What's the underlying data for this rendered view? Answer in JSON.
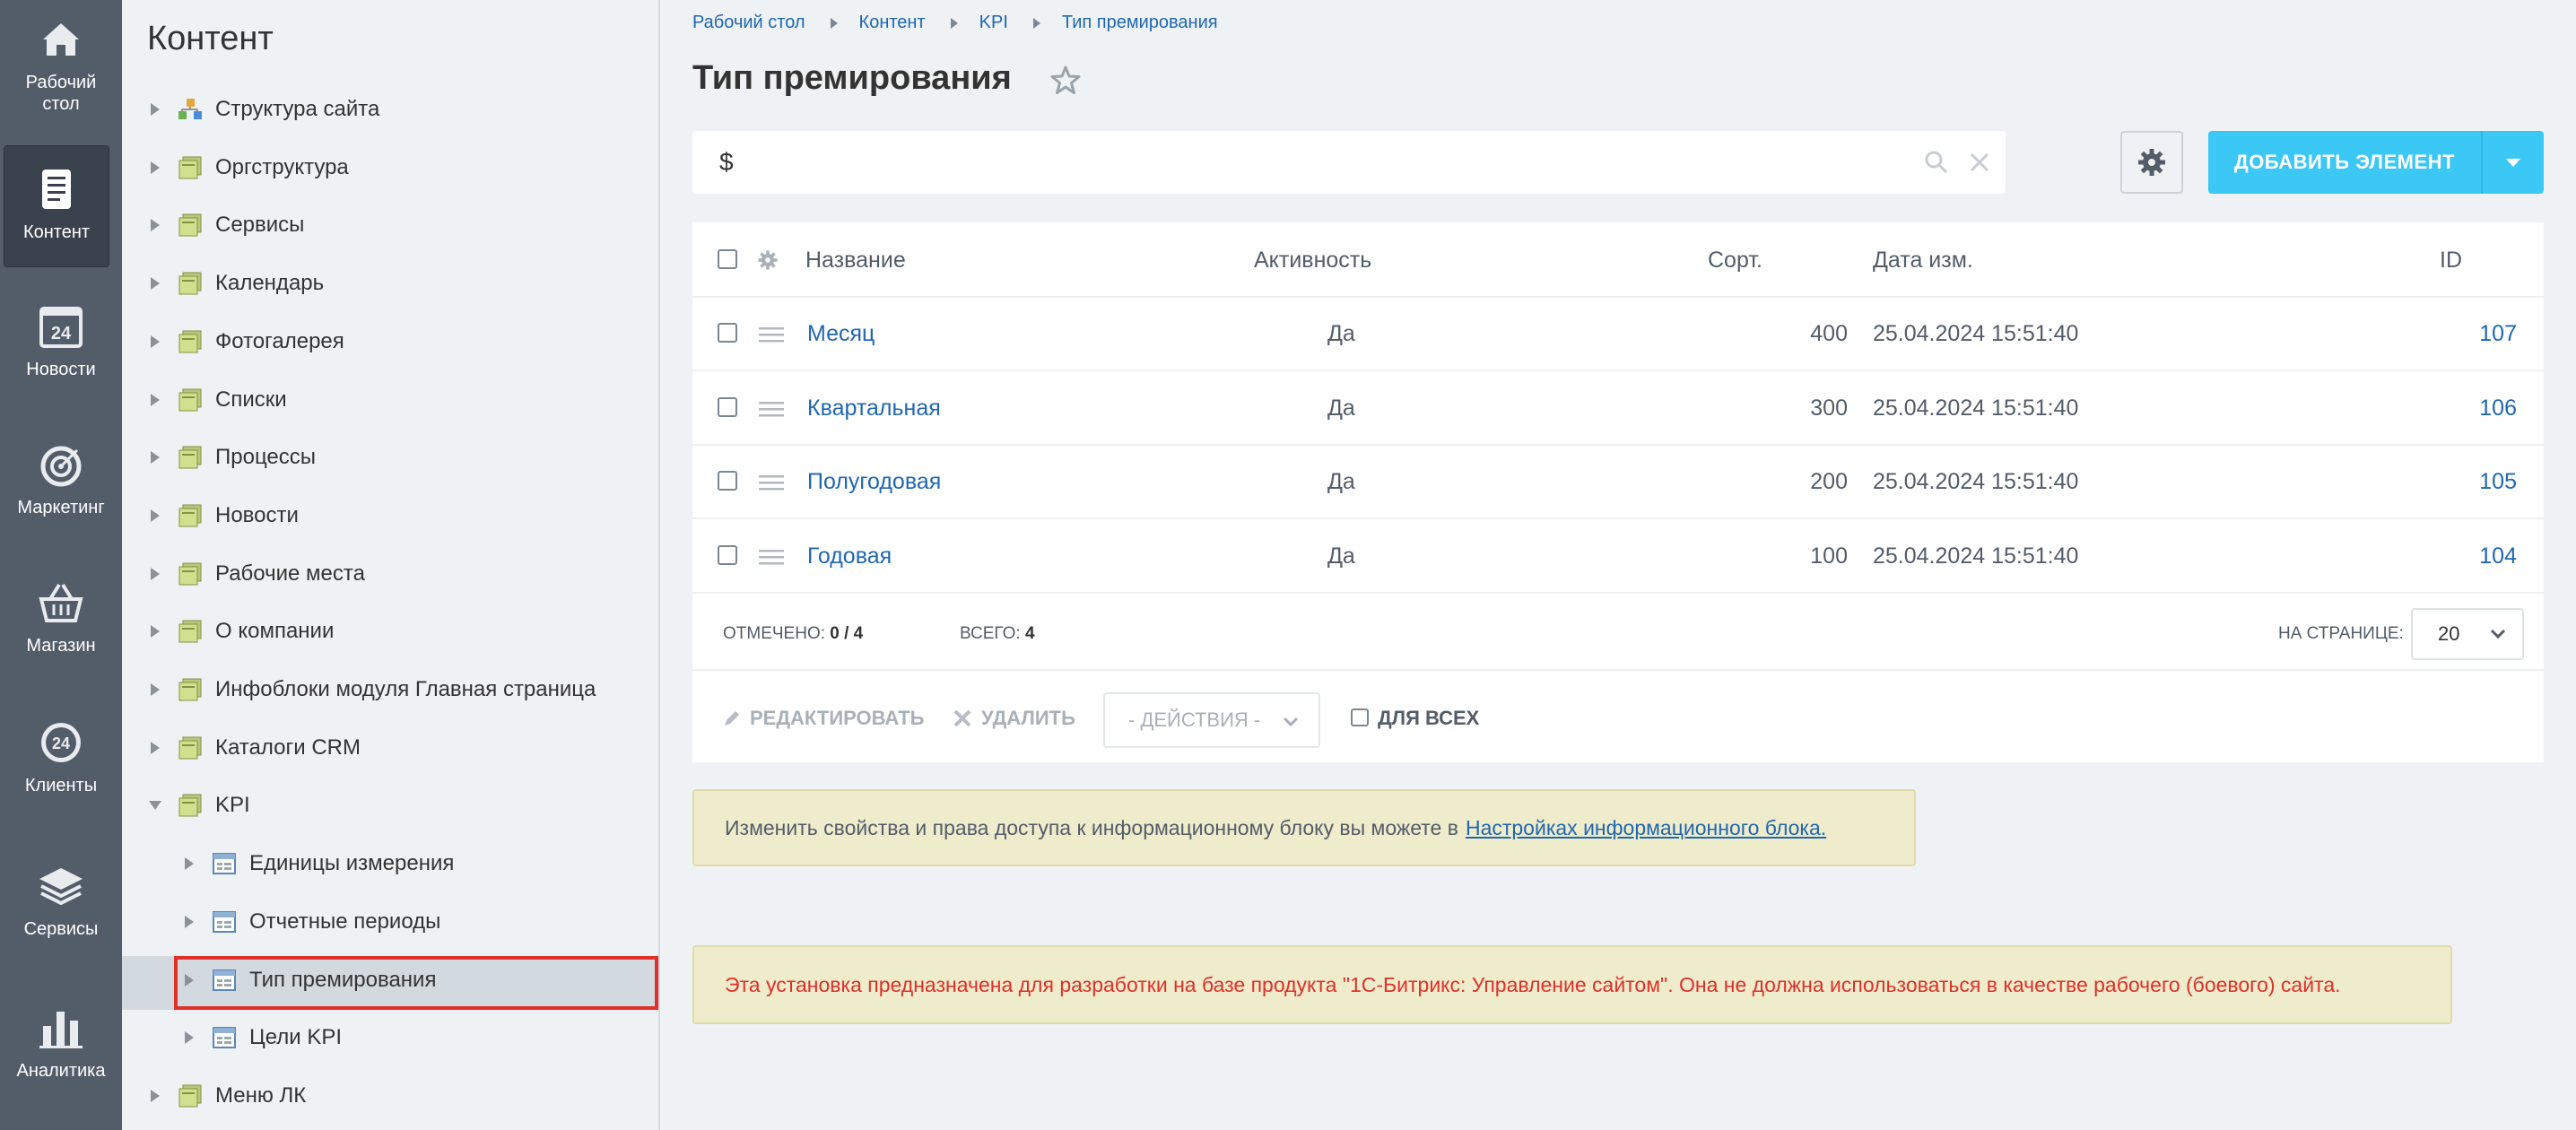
{
  "iconbar": {
    "items": [
      {
        "label_l1": "Рабочий",
        "label_l2": "стол",
        "icon": "home-icon"
      },
      {
        "label_l1": "Контент",
        "icon": "document-icon",
        "active": true
      },
      {
        "label_l1": "Новости",
        "icon": "calendar-24-icon"
      },
      {
        "label_l1": "Маркетинг",
        "icon": "target-icon"
      },
      {
        "label_l1": "Магазин",
        "icon": "basket-icon"
      },
      {
        "label_l1": "Клиенты",
        "icon": "clients-24-icon"
      },
      {
        "label_l1": "Сервисы",
        "icon": "layers-icon"
      },
      {
        "label_l1": "Аналитика",
        "icon": "bar-chart-icon"
      }
    ]
  },
  "tree": {
    "title": "Контент",
    "nodes": [
      {
        "label": "Структура сайта",
        "icon": "site-structure-icon"
      },
      {
        "label": "Оргструктура",
        "icon": "folder-icon"
      },
      {
        "label": "Сервисы",
        "icon": "folder-icon"
      },
      {
        "label": "Календарь",
        "icon": "folder-icon"
      },
      {
        "label": "Фотогалерея",
        "icon": "folder-icon"
      },
      {
        "label": "Списки",
        "icon": "folder-icon"
      },
      {
        "label": "Процессы",
        "icon": "folder-icon"
      },
      {
        "label": "Новости",
        "icon": "folder-icon"
      },
      {
        "label": "Рабочие места",
        "icon": "folder-icon"
      },
      {
        "label": "О компании",
        "icon": "folder-icon"
      },
      {
        "label": "Инфоблоки модуля Главная страница",
        "icon": "folder-icon"
      },
      {
        "label": "Каталоги CRM",
        "icon": "folder-icon"
      },
      {
        "label": "KPI",
        "icon": "folder-icon",
        "expanded": true
      },
      {
        "label": "Единицы измерения",
        "icon": "iblock-icon"
      },
      {
        "label": "Отчетные периоды",
        "icon": "iblock-icon"
      },
      {
        "label": "Тип премирования",
        "icon": "iblock-icon",
        "selected": true
      },
      {
        "label": "Цели KPI",
        "icon": "iblock-icon"
      },
      {
        "label": "Меню ЛК",
        "icon": "folder-icon"
      }
    ]
  },
  "breadcrumbs": [
    "Рабочий стол",
    "Контент",
    "KPI",
    "Тип премирования"
  ],
  "page_title": "Тип премирования",
  "search": {
    "value": "$",
    "placeholder": ""
  },
  "add_button_label": "ДОБАВИТЬ ЭЛЕМЕНТ",
  "grid": {
    "headers": {
      "name": "Название",
      "active": "Активность",
      "sort": "Сорт.",
      "date": "Дата изм.",
      "id": "ID"
    },
    "rows": [
      {
        "name": "Месяц",
        "active": "Да",
        "sort": "400",
        "date": "25.04.2024 15:51:40",
        "id": "107"
      },
      {
        "name": "Квартальная",
        "active": "Да",
        "sort": "300",
        "date": "25.04.2024 15:51:40",
        "id": "106"
      },
      {
        "name": "Полугодовая",
        "active": "Да",
        "sort": "200",
        "date": "25.04.2024 15:51:40",
        "id": "105"
      },
      {
        "name": "Годовая",
        "active": "Да",
        "sort": "100",
        "date": "25.04.2024 15:51:40",
        "id": "104"
      }
    ],
    "footer": {
      "checked_label": "ОТМЕЧЕНО:",
      "checked_value": "0 / 4",
      "total_label": "ВСЕГО:",
      "total_value": "4",
      "per_page_label": "НА СТРАНИЦЕ:",
      "per_page_value": "20"
    },
    "actions": {
      "edit": "РЕДАКТИРОВАТЬ",
      "delete": "УДАЛИТЬ",
      "actions_select": "- ДЕЙСТВИЯ -",
      "for_all": "ДЛЯ ВСЕХ"
    }
  },
  "notice": {
    "text": "Изменить свойства и права доступа к информационному блоку вы можете в",
    "link": "Настройках информационного блока."
  },
  "warning": "Эта установка предназначена для разработки на базе продукта \"1С-Битрикс: Управление сайтом\". Она не должна использоваться в качестве рабочего (боевого) сайта.",
  "colors": {
    "accent": "#3bc8f5",
    "link": "#2067b0",
    "warning_text": "#e0302a",
    "sidebar": "#535c69"
  }
}
